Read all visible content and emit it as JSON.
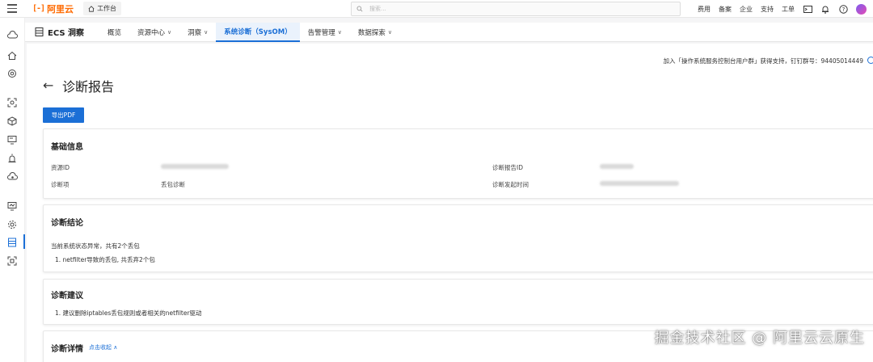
{
  "topbar": {
    "logo_mark": "[-]",
    "logo_text": "阿里云",
    "workbench": "工作台",
    "search_placeholder": "搜索...",
    "links": [
      "费用",
      "备案",
      "企业",
      "支持",
      "工单"
    ]
  },
  "product": {
    "name": "ECS 洞察",
    "nav": [
      {
        "label": "概览",
        "dropdown": false,
        "active": false
      },
      {
        "label": "资源中心",
        "dropdown": true,
        "active": false
      },
      {
        "label": "洞察",
        "dropdown": true,
        "active": false
      },
      {
        "label": "系统诊断（SysOM）",
        "dropdown": false,
        "active": true
      },
      {
        "label": "告警管理",
        "dropdown": true,
        "active": false
      },
      {
        "label": "数据探索",
        "dropdown": true,
        "active": false
      }
    ]
  },
  "page": {
    "support_text": "加入「操作系统服务控制台用户群」获得支持，钉钉群号：94405014449",
    "title": "诊断报告",
    "export_pdf": "导出PDF"
  },
  "basic_info": {
    "title": "基础信息",
    "resource_id_label": "资源ID",
    "report_id_label": "诊断报告ID",
    "item_label": "诊断项",
    "item_value": "丢包诊断",
    "time_label": "诊断发起时间"
  },
  "conclusion": {
    "title": "诊断结论",
    "summary": "当前系统状态异常，共有2个丢包",
    "detail": "1. netfilter导致的丢包, 共丢弃2个包"
  },
  "suggestion": {
    "title": "诊断建议",
    "item": "1. 建议删除iptables丢包规则或者相关的netfilter驱动"
  },
  "details": {
    "title": "诊断详情",
    "collapse": "点击收起"
  },
  "watermark": "掘金技术社区 @ 阿里云云原生",
  "colors": {
    "accent": "#1b6fd6",
    "brand": "#ff6a00"
  }
}
